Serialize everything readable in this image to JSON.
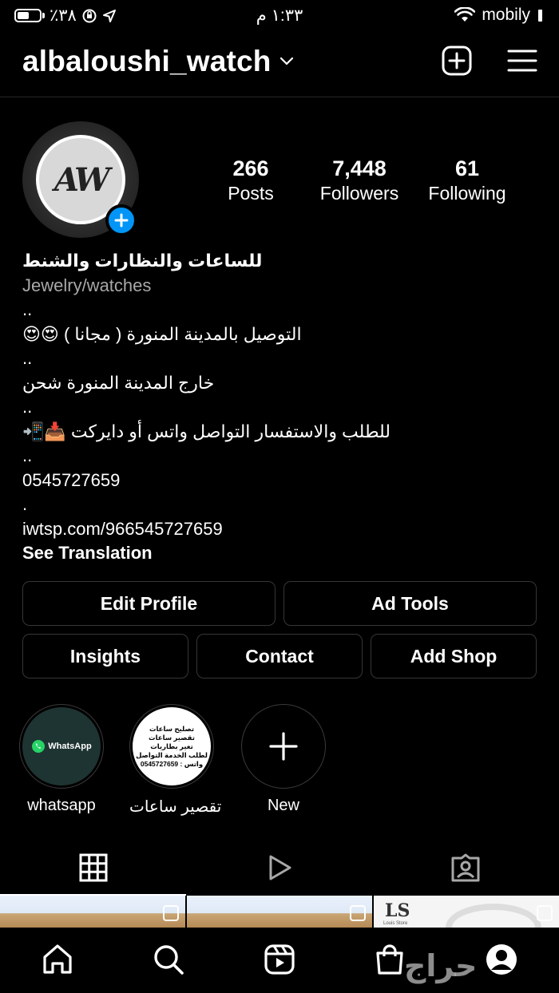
{
  "status_bar": {
    "battery_percent": "٪٣٨",
    "time": "١:٣٣ م",
    "carrier": "mobily"
  },
  "header": {
    "username": "albaloushi_watch",
    "icons": [
      "chevron-down-icon",
      "new-post-icon",
      "menu-icon"
    ]
  },
  "profile": {
    "avatar_text": "AW",
    "stats": [
      {
        "value": "266",
        "label": "Posts"
      },
      {
        "value": "7,448",
        "label": "Followers"
      },
      {
        "value": "61",
        "label": "Following"
      }
    ],
    "name": "للساعات والنظارات والشنط",
    "category": "Jewelry/watches",
    "bio_lines": [
      "..",
      "التوصيل بالمدينة المنورة ( مجانا ) 😍😍",
      "..",
      "خارج المدينة المنورة شحن",
      "..",
      "للطلب والاستفسار التواصل واتس أو دايركت 📥📲",
      "..",
      "0545727659",
      ".",
      "iwtsp.com/966545727659"
    ],
    "see_translation": "See Translation"
  },
  "buttons": {
    "edit_profile": "Edit Profile",
    "ad_tools": "Ad Tools",
    "insights": "Insights",
    "contact": "Contact",
    "add_shop": "Add Shop"
  },
  "highlights": [
    {
      "label": "whatsapp",
      "badge_text": "WhatsApp"
    },
    {
      "label": "تقصير ساعات",
      "cover_lines": [
        "تصليح ساعات",
        "تقصير ساعات",
        "تغير بطاريات",
        "لطلب الخدمة التواصل",
        "واتس : 0545727659"
      ]
    },
    {
      "label": "New"
    }
  ],
  "grid": {
    "logo_text": "LS",
    "logo_subtext": "Louis Store"
  },
  "watermark": "حراج",
  "colors": {
    "background": "#000000",
    "divider": "#262626",
    "button_border": "#363636",
    "accent_blue": "#0095f6",
    "secondary_text": "#a8a8a8",
    "whatsapp_green": "#25d366"
  }
}
